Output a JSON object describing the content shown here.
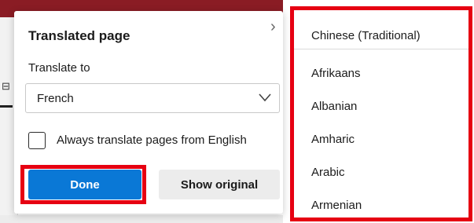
{
  "panel": {
    "title": "Translated page",
    "translate_to_label": "Translate to",
    "selected_language": "French",
    "checkbox_label": "Always translate pages from English",
    "checkbox_checked": false,
    "done_label": "Done",
    "show_original_label": "Show original"
  },
  "dropdown": {
    "selected": "Chinese (Traditional)",
    "items": [
      "Afrikaans",
      "Albanian",
      "Amharic",
      "Arabic",
      "Armenian"
    ]
  },
  "colors": {
    "accent": "#0a78d6",
    "highlight": "#e60012",
    "browser_bar": "#8a1c24"
  }
}
